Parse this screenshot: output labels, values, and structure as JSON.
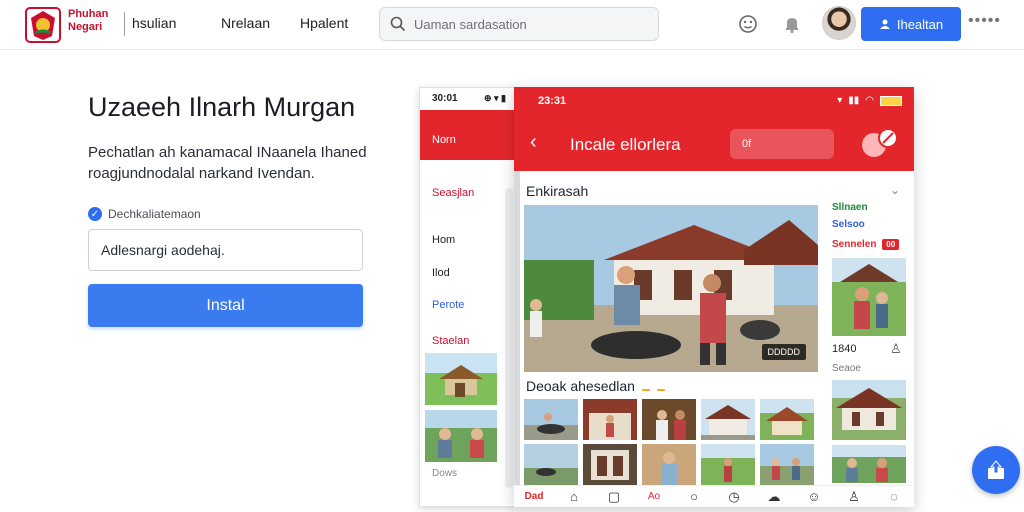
{
  "header": {
    "brand_line1": "Phuhan",
    "brand_line2": "Negari",
    "nav": [
      "hsulian",
      "Nrelaan",
      "Hpalent"
    ],
    "search_placeholder": "Uaman sardasation",
    "signin_label": "Ihealtan",
    "more": "•••••"
  },
  "hero": {
    "title": "Uzaeeh Ilnarh Murgan",
    "description": "Pechatlan ah kanamacal INaanela Ihaned roagjundnodalal narkand Ivendan.",
    "checkbox_label": "Dechkaliatemaon",
    "email_value": "Adlesnargi aodehaj.",
    "install_label": "Instal"
  },
  "phone_back": {
    "time": "30:01",
    "status_icons": "⊕ ▾ ▮",
    "header_label": "Norn",
    "items": [
      {
        "label": "Seasjlan",
        "color": "#c8102e"
      },
      {
        "label": "Hom",
        "color": "#222222"
      },
      {
        "label": "Ilod",
        "color": "#222222"
      },
      {
        "label": "Perote",
        "color": "#2f5fd0"
      },
      {
        "label": "Staelan",
        "color": "#c8102e"
      }
    ],
    "footer_label": "Dows"
  },
  "phone_front": {
    "time": "23:31",
    "header_title": "Incale ellorlera",
    "pill_text": "0f",
    "section1": "Enkirasah",
    "photo_badge": "DDDDD",
    "side": {
      "title1": "Sllnaen",
      "title2": "Selsoo",
      "title3": "Sennelen",
      "tag3": "00",
      "number": "1840",
      "caption": "Seaoe"
    },
    "section2": "Deoak ahesedlan",
    "section2_tags": [
      "",
      ""
    ]
  },
  "colors": {
    "primary_red": "#e3262c",
    "primary_blue": "#2f6ef0"
  }
}
